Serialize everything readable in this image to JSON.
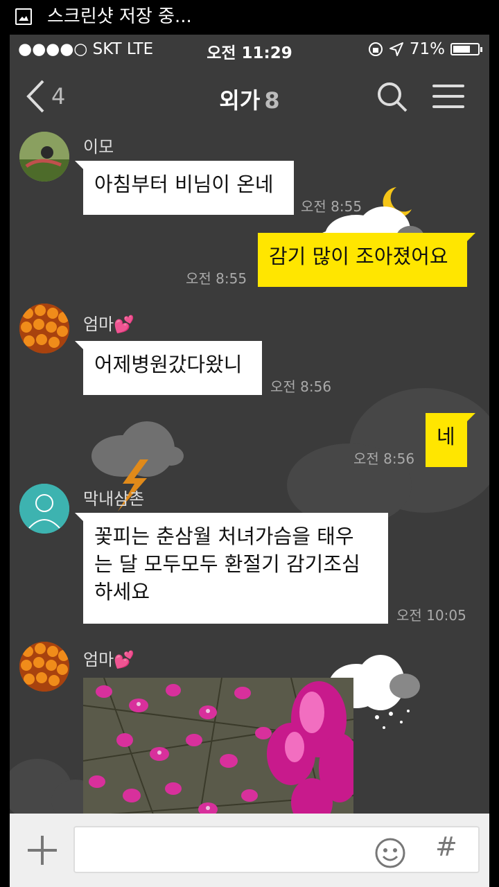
{
  "android_status": {
    "notification": "스크린샷 저장 중..."
  },
  "ios_status": {
    "carrier": "●●●●○ SKT   LTE",
    "time": "오전 11:29",
    "battery": "71%",
    "battery_level": 0.71
  },
  "header": {
    "back_count": "4",
    "title": "외가",
    "member_count": "8"
  },
  "messages": [
    {
      "sender": "이모",
      "text": "아침부터 비님이 온네",
      "time": "오전 8:55"
    },
    {
      "text": "감기 많이 조아졌어요",
      "time": "오전 8:55"
    },
    {
      "sender": "엄마💕",
      "text": "어제병원갔다왔니",
      "time": "오전 8:56"
    },
    {
      "text": "네",
      "time": "오전 8:56"
    },
    {
      "sender": "막내삼촌",
      "line1": "꽃피는 춘삼월 처녀가슴을 태우",
      "line2": "는 달 모두모두  환절기 감기조심",
      "line3": "하세요",
      "time": "오전 10:05"
    },
    {
      "sender": "엄마💕"
    }
  ],
  "input": {
    "value": ""
  },
  "colors": {
    "background": "#3b3b3b",
    "my_bubble": "#ffe600",
    "their_bubble": "#ffffff"
  }
}
